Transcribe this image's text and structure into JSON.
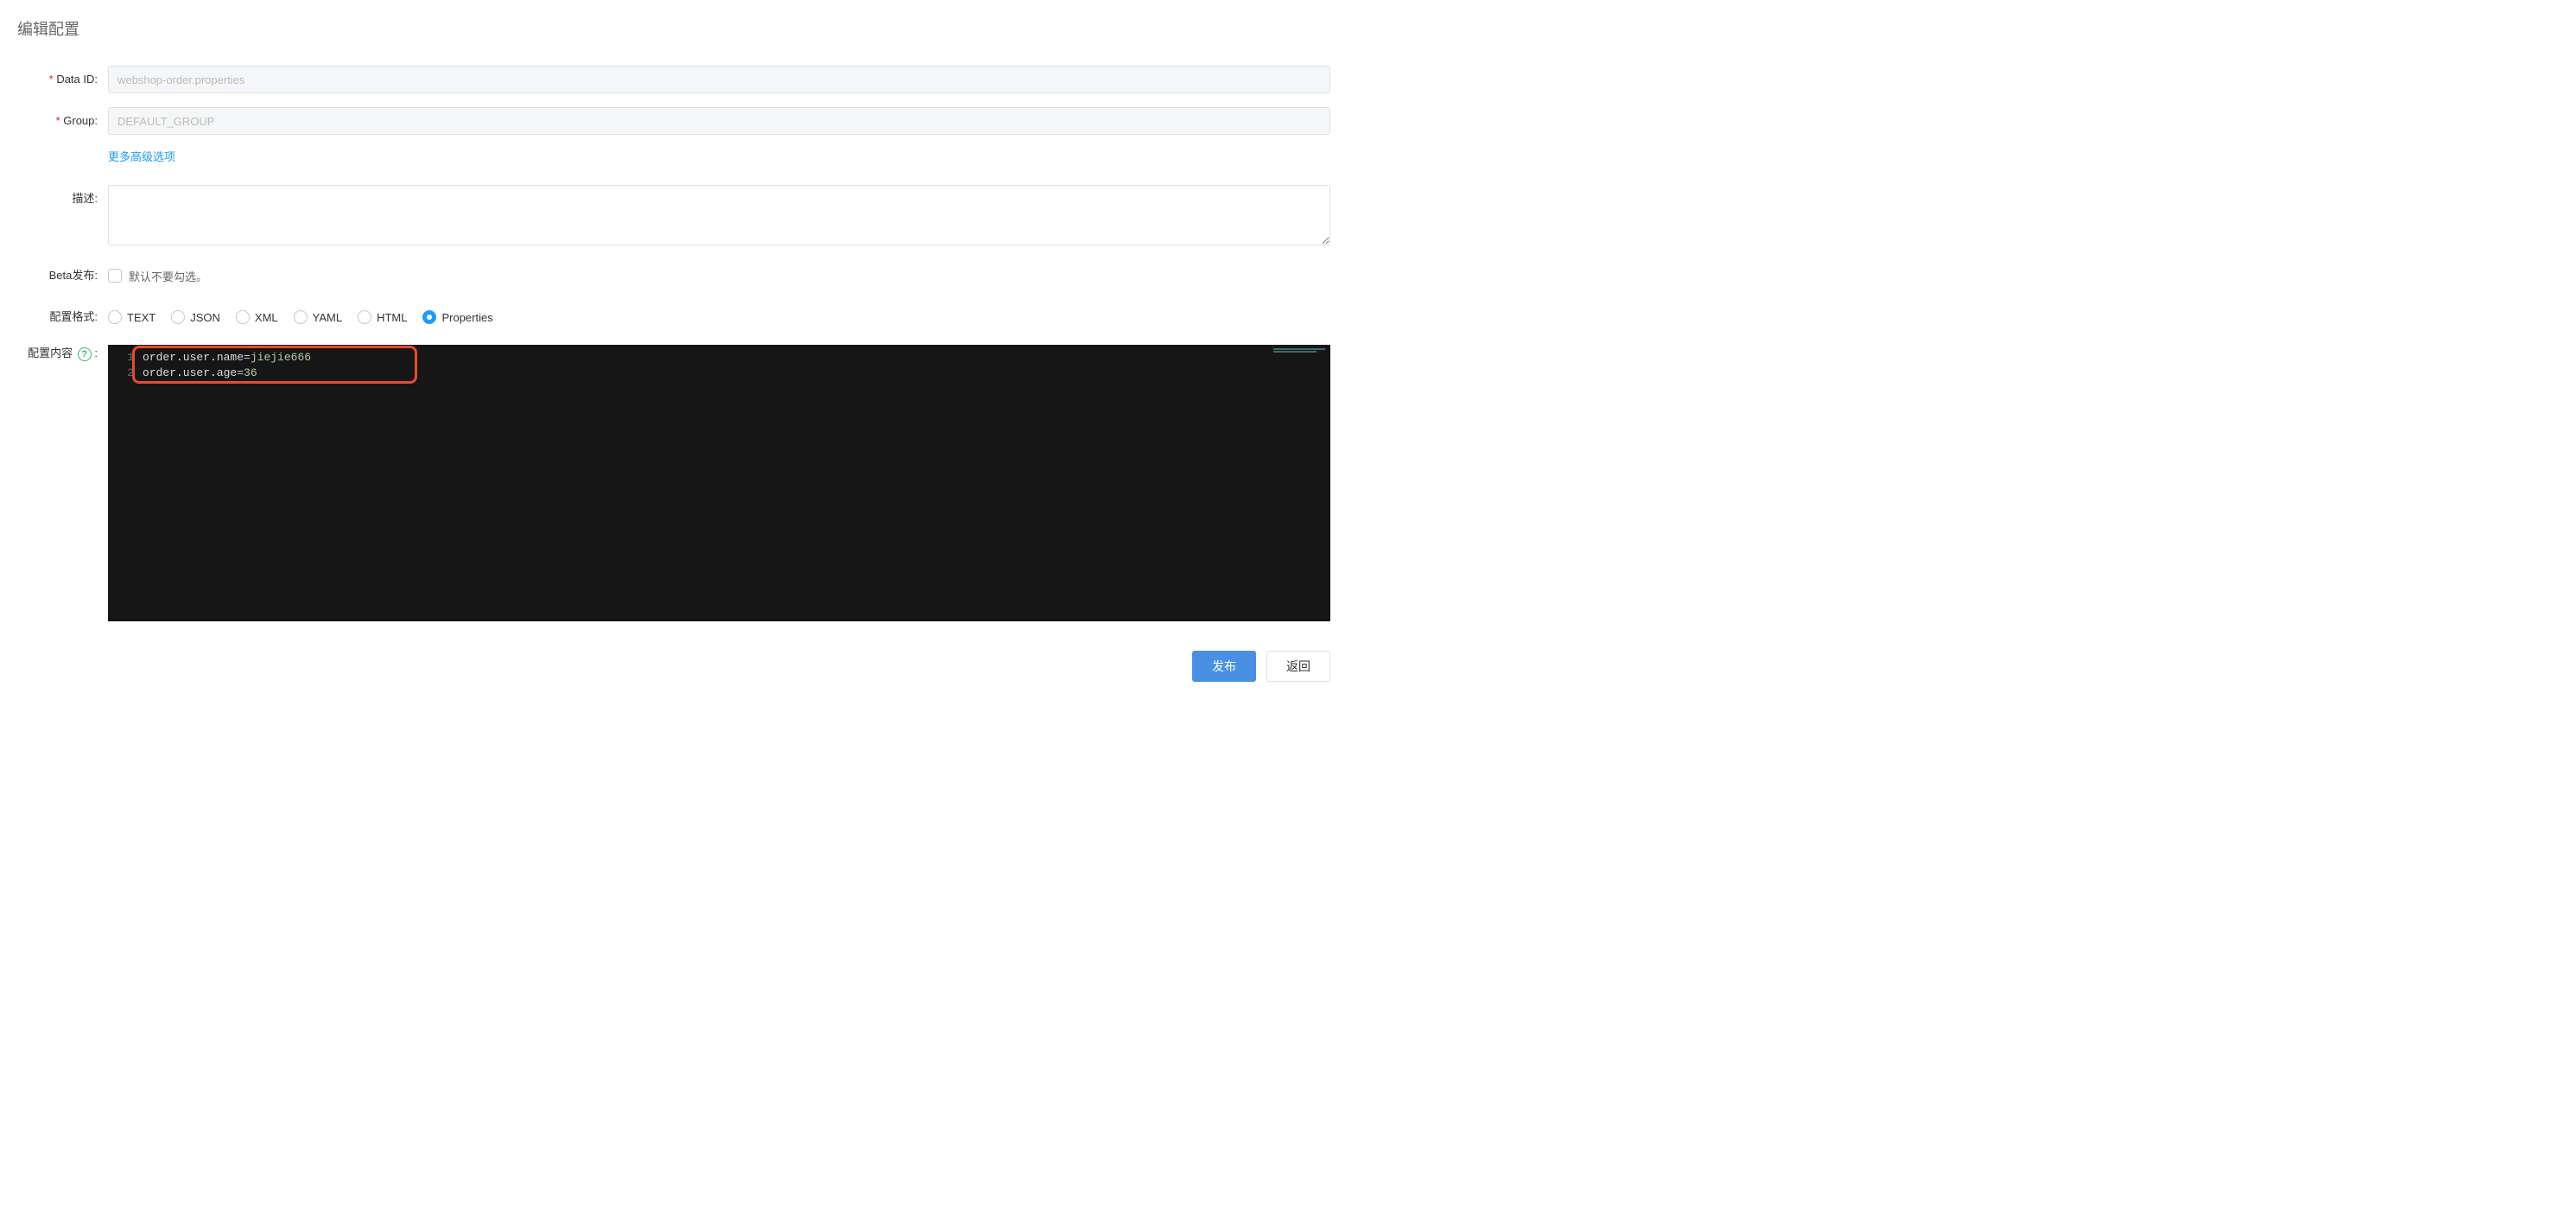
{
  "title": "编辑配置",
  "labels": {
    "data_id": "Data ID:",
    "group": "Group:",
    "advanced": "更多高级选项",
    "description": "描述:",
    "beta": "Beta发布:",
    "beta_hint": "默认不要勾选。",
    "format": "配置格式:",
    "content": "配置内容",
    "content_suffix": ":"
  },
  "fields": {
    "data_id": "webshop-order.properties",
    "group": "DEFAULT_GROUP",
    "description": "",
    "beta_checked": false
  },
  "formats": [
    {
      "label": "TEXT",
      "checked": false
    },
    {
      "label": "JSON",
      "checked": false
    },
    {
      "label": "XML",
      "checked": false
    },
    {
      "label": "YAML",
      "checked": false
    },
    {
      "label": "HTML",
      "checked": false
    },
    {
      "label": "Properties",
      "checked": true
    }
  ],
  "editor_lines": [
    {
      "n": "1",
      "key": "order.user.name",
      "value": "jiejie666"
    },
    {
      "n": "2",
      "key": "order.user.age",
      "value": "36"
    }
  ],
  "buttons": {
    "publish": "发布",
    "back": "返回"
  }
}
